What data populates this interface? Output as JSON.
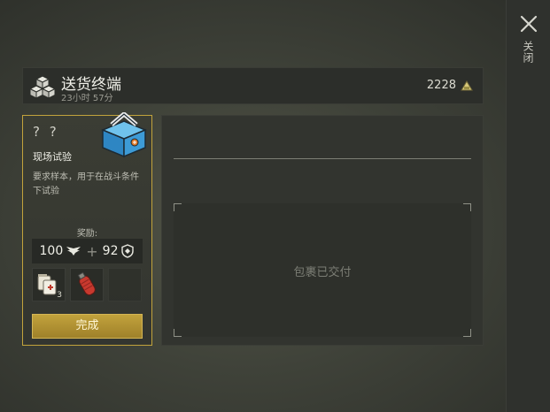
{
  "side_panel": {
    "close_label": "关闭"
  },
  "header": {
    "title": "送货终端",
    "timer": "23小时 57分",
    "currency_amount": "2228"
  },
  "quest_card": {
    "unknown": "? ?",
    "title": "现场试验",
    "description": "要求样本，用于在战斗条件下试验",
    "reward_label": "奖励:",
    "reward_primary": "100",
    "reward_secondary": "92",
    "item_slot_1_count": "3",
    "complete_label": "完成"
  },
  "delivery": {
    "status_text": "包裹已交付"
  },
  "icons": [
    "close-icon",
    "cubes-icon",
    "currency-icon",
    "cooler-box-icon",
    "wings-icon",
    "shield-icon",
    "medkit-icon",
    "gas-canister-icon"
  ],
  "colors": {
    "accent_gold": "#c2a33c",
    "background": "#3f4239",
    "panel": "#32342f"
  }
}
